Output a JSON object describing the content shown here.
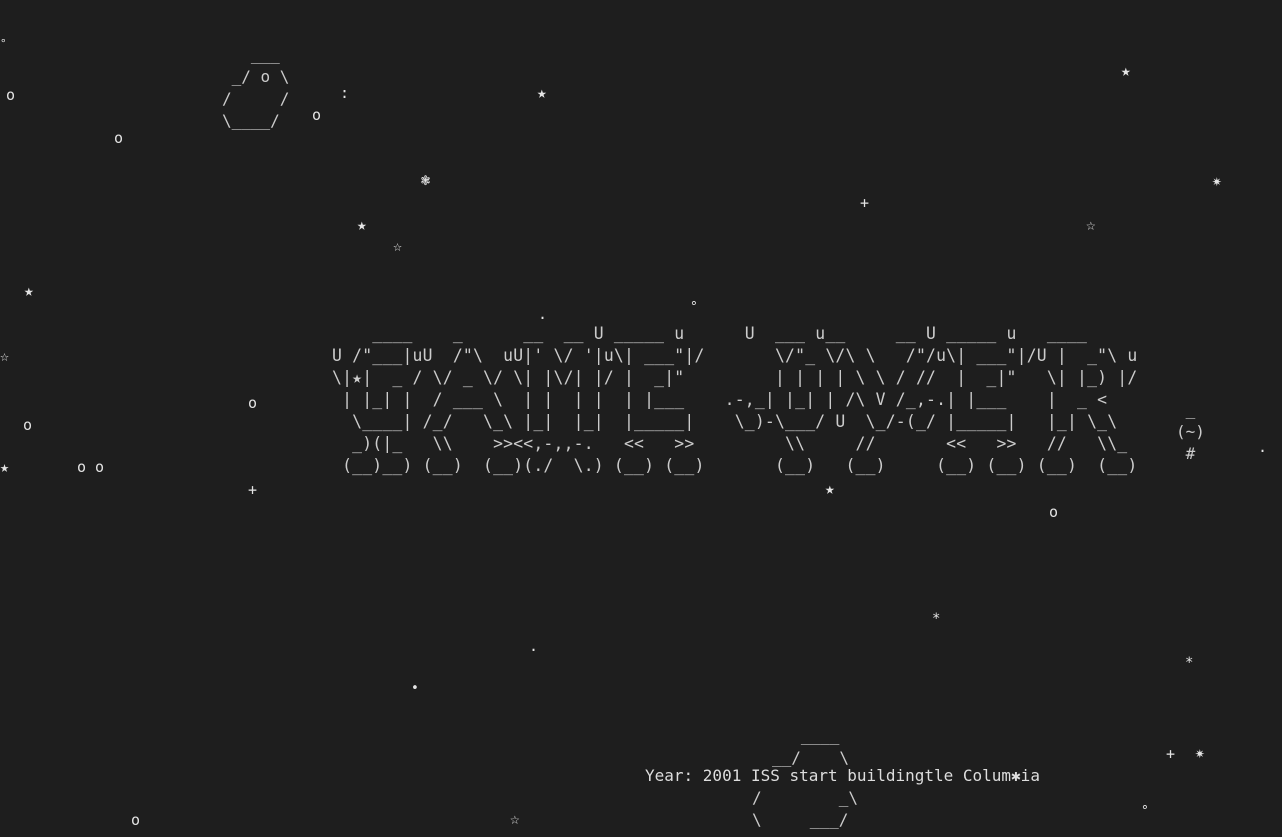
{
  "status": {
    "text": "Year: 2001 ISS start buildingtle Colum✱ia"
  },
  "title_art": {
    "lines": [
      "    ____    _      __  __ U _____ u      U  ___ u__     __ U _____ u   ____",
      "U /\"___|uU  /\"\\  uU|' \\/ '|u\\| ___\"|/       \\/\"_ \\/\\ \\   /\"/u\\| ___\"|/U |  _\"\\ u",
      "\\|★|  _ / \\/ _ \\/ \\| |\\/| |/ |  _|\"         | | | | \\ \\ / //  |  _|\"   \\| |_) |/",
      " | |_| |  / ___ \\  | |  | |  | |___    .-,_| |_| | /\\ V /_,-.| |___    |  _ <",
      "  \\____| /_/   \\_\\ |_|  |_|  |_____|    \\_)-\\___/ U  \\_/-(_/ |_____|   |_| \\_\\",
      "  _)(|_   \\\\    >><<,-,,-.   <<   >>         \\\\     //       <<   >>   //   \\\\_",
      " (__)__) (__)  (__)(./  \\.) (__) (__)       (__)   (__)     (__) (__) (__)  (__)"
    ]
  },
  "asteroid": {
    "lines": [
      "   ___",
      " _/ o \\",
      "/     /",
      "\\____/"
    ]
  },
  "ship": {
    "top_lines": [
      "   ____",
      "__/    \\"
    ],
    "bottom_lines": [
      "/        _\\",
      "\\     ___/"
    ]
  },
  "alien": {
    "lines": [
      " _",
      "(~)",
      " #"
    ]
  },
  "stars": [
    {
      "glyph": "°",
      "icon": "degree-star"
    },
    {
      "glyph": "o",
      "icon": "circle-star"
    },
    {
      "glyph": ":",
      "icon": "colon-star"
    },
    {
      "glyph": "o",
      "icon": "circle-star"
    },
    {
      "glyph": "o",
      "icon": "circle-star"
    },
    {
      "glyph": "★",
      "icon": "filled-star"
    },
    {
      "glyph": "★",
      "icon": "filled-star"
    },
    {
      "glyph": "❃",
      "icon": "snowflake-star"
    },
    {
      "glyph": "✷",
      "icon": "burst-star"
    },
    {
      "glyph": "+",
      "icon": "plus-star"
    },
    {
      "glyph": "★",
      "icon": "filled-star"
    },
    {
      "glyph": "☆",
      "icon": "outline-star"
    },
    {
      "glyph": "☆",
      "icon": "outline-star"
    },
    {
      "glyph": "★",
      "icon": "filled-star"
    },
    {
      "glyph": ".",
      "icon": "dot-star"
    },
    {
      "glyph": "°",
      "icon": "degree-star"
    },
    {
      "glyph": "☆",
      "icon": "outline-star"
    },
    {
      "glyph": "o",
      "icon": "circle-star"
    },
    {
      "glyph": "o",
      "icon": "circle-star"
    },
    {
      "glyph": "★",
      "icon": "filled-star"
    },
    {
      "glyph": "o o",
      "icon": "circle-star"
    },
    {
      "glyph": ".",
      "icon": "dot-star"
    },
    {
      "glyph": "+",
      "icon": "plus-star"
    },
    {
      "glyph": "★",
      "icon": "filled-star"
    },
    {
      "glyph": "o",
      "icon": "circle-star"
    },
    {
      "glyph": "*",
      "icon": "asterisk-star"
    },
    {
      "glyph": ".",
      "icon": "dot-star"
    },
    {
      "glyph": "*",
      "icon": "asterisk-star"
    },
    {
      "glyph": "•",
      "icon": "bullet-star"
    },
    {
      "glyph": "+",
      "icon": "plus-star"
    },
    {
      "glyph": "✷",
      "icon": "burst-star"
    },
    {
      "glyph": "o",
      "icon": "circle-star"
    },
    {
      "glyph": "☆",
      "icon": "outline-star"
    },
    {
      "glyph": "°",
      "icon": "degree-star"
    }
  ]
}
